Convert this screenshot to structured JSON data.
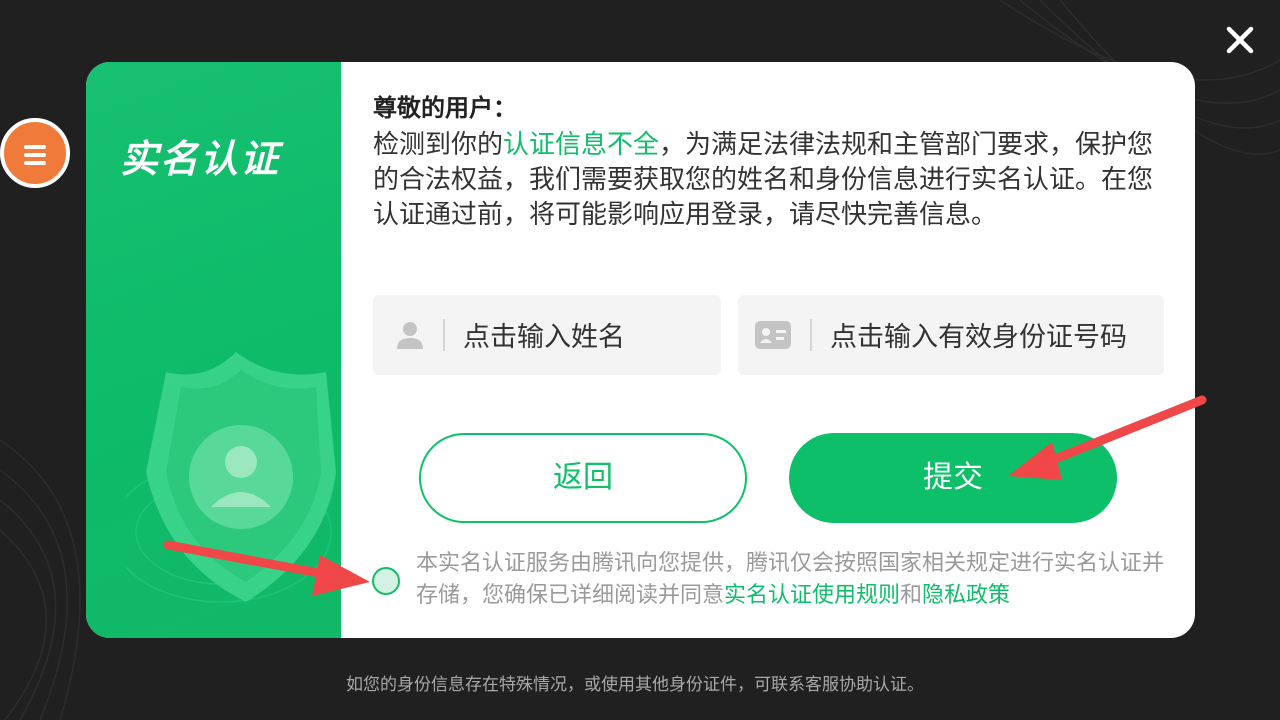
{
  "menu_icon": "menu-icon",
  "close_icon": "close-icon",
  "dialog": {
    "left_title": "实名认证",
    "greeting": "尊敬的用户：",
    "description": {
      "part1": "检测到你的",
      "highlight": "认证信息不全",
      "part2": "，为满足法律法规和主管部门要求，保护您的合法权益，我们需要获取您的姓名和身份信息进行实名认证。在您认证通过前，将可能影响应用登录，请尽快完善信息。"
    },
    "name_field": {
      "icon": "user-icon",
      "placeholder": "点击输入姓名"
    },
    "id_field": {
      "icon": "id-card-icon",
      "placeholder": "点击输入有效身份证号码"
    },
    "back_label": "返回",
    "submit_label": "提交",
    "agreement": {
      "text1": "本实名认证服务由腾讯向您提供，腾讯仅会按照国家相关规定进行实名认证并存储，您确保已详细阅读并同意",
      "link1": "实名认证使用规则",
      "and": "和",
      "link2": "隐私政策"
    }
  },
  "footer_note": "如您的身份信息存在特殊情况，或使用其他身份证件，可联系客服协助认证。",
  "colors": {
    "accent": "#0fbd6a",
    "menu": "#f07a3a",
    "annotation_arrow": "#f04848"
  }
}
